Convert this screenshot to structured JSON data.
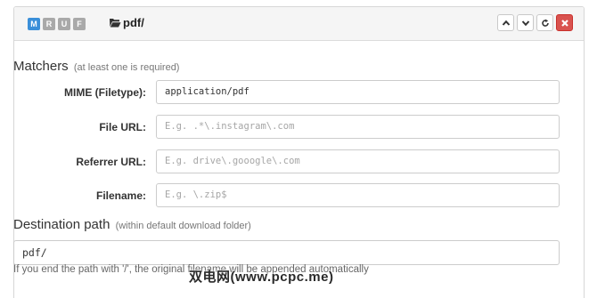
{
  "header": {
    "flags": [
      {
        "label": "M",
        "color": "#3a8fd9"
      },
      {
        "label": "R",
        "color": "#a9a9a9"
      },
      {
        "label": "U",
        "color": "#a9a9a9"
      },
      {
        "label": "F",
        "color": "#a9a9a9"
      }
    ],
    "title": "pdf/",
    "actions": [
      {
        "name": "move-up-button",
        "icon": "chevron-up-icon"
      },
      {
        "name": "move-down-button",
        "icon": "chevron-down-icon"
      },
      {
        "name": "refresh-button",
        "icon": "refresh-icon"
      },
      {
        "name": "delete-button",
        "icon": "close-icon",
        "color": "#d9534f"
      }
    ]
  },
  "matchers": {
    "title": "Matchers",
    "hint": "(at least one is required)",
    "fields": [
      {
        "label": "MIME (Filetype):",
        "value": "application/pdf",
        "placeholder": ""
      },
      {
        "label": "File URL:",
        "value": "",
        "placeholder": "E.g. .*\\.instagram\\.com"
      },
      {
        "label": "Referrer URL:",
        "value": "",
        "placeholder": "E.g. drive\\.gooogle\\.com"
      },
      {
        "label": "Filename:",
        "value": "",
        "placeholder": "E.g. \\.zip$"
      }
    ]
  },
  "destination": {
    "title": "Destination path",
    "hint": "(within default download folder)",
    "value": "pdf/",
    "help": "If you end the path with '/', the original filename will be appended automatically"
  },
  "watermark": "双电网(www.pcpc.me)"
}
